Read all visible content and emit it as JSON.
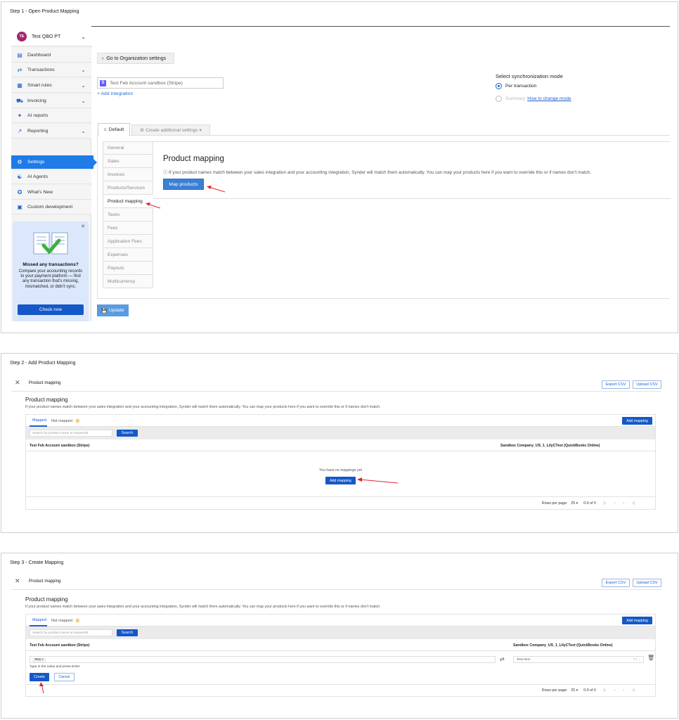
{
  "step1": {
    "title": "Step 1 - Open Product Mapping",
    "org": {
      "initials": "TE",
      "name": "Test QBO PT"
    },
    "nav": [
      {
        "label": "Dashboard",
        "icon": "dashboard-icon"
      },
      {
        "label": "Transactions",
        "icon": "transactions-icon"
      },
      {
        "label": "Smart rules",
        "icon": "smart-rules-icon"
      },
      {
        "label": "Invoicing",
        "icon": "cart-icon"
      },
      {
        "label": "AI reports",
        "icon": "sparkle-icon"
      },
      {
        "label": "Reporting",
        "icon": "chart-line-icon"
      },
      {
        "label": "Settings",
        "icon": "gear-icon"
      },
      {
        "label": "AI Agents",
        "icon": "ai-agents-icon"
      },
      {
        "label": "What's New",
        "icon": "star-icon"
      },
      {
        "label": "Custom development",
        "icon": "code-icon"
      }
    ],
    "promo": {
      "title": "Missed any transactions?",
      "text": "Compare your accounting records to your payment platform — find any transaction that's missing, mismatched, or didn't sync.",
      "button": "Check now"
    },
    "back_button": "Go to Organization settings",
    "integration_value": "Test Feb Account  sandbox (Stripe)",
    "add_integration": "Add integration",
    "sync": {
      "title": "Select synchronization mode",
      "per_transaction": "Per transaction",
      "summary": "Summary",
      "how_link": "How to change mode"
    },
    "tabs": {
      "default": "Default",
      "create": "Create additional settings"
    },
    "menu": [
      "General",
      "Sales",
      "Invoices",
      "Products/Services",
      "Product mapping",
      "Taxes",
      "Fees",
      "Application Fees",
      "Expenses",
      "Payouts",
      "Multicurrency"
    ],
    "panel": {
      "title": "Product mapping",
      "info": "If your product names match between your sales integration and your accounting integration, Synder will match them automatically. You can map your products here if you want to override this or if names don't match.",
      "button": "Map products"
    },
    "update_button": "Update"
  },
  "step2": {
    "title": "Step 2 - Add Product Mapping",
    "header": "Product mapping",
    "export_csv": "Export CSV",
    "upload_csv": "Upload CSV",
    "page_title": "Product mapping",
    "description": "If your product names match between your sales integration and your accounting integration, Synder will match them automatically. You can map your products here if you want to override this or if names don't match.",
    "tab_mapped": "Mapped",
    "tab_not_mapped": "Not mapped",
    "not_mapped_count": "0",
    "add_mapping": "Add mapping",
    "search_placeholder": "Search by product name or keywords",
    "search_button": "Search",
    "col_left": "Test Feb Account sandbox (Stripe)",
    "col_right": "Sandbox Company_US_1_LilyCTest (QuickBooks Online)",
    "empty_text": "You have no mappings yet",
    "empty_button": "Add mapping",
    "rows_per_page_label": "Rows per page:",
    "rows_per_page": "25",
    "range": "0-0 of 0"
  },
  "step3": {
    "title": "Step 3 - Create Mapping",
    "header": "Product mapping",
    "export_csv": "Export CSV",
    "upload_csv": "Upload CSV",
    "page_title": "Product mapping",
    "description": "If your product names match between your sales integration and your accounting integration, Synder will match them automatically. You can map your products here if you want to override this or if names don't match.",
    "tab_mapped": "Mapped",
    "tab_not_mapped": "Not mapped",
    "not_mapped_count": "0",
    "add_mapping": "Add mapping",
    "search_placeholder": "Search by product name or keywords",
    "search_button": "Search",
    "col_left": "Test Feb Account sandbox (Stripe)",
    "col_right": "Sandbox Company_US_1_LilyCTest (QuickBooks Online)",
    "tag_value": "Test",
    "hint": "Type in the value and press Enter",
    "select_value": "Test Item",
    "create_button": "Create",
    "cancel_button": "Cancel",
    "rows_per_page_label": "Rows per page:",
    "rows_per_page": "25",
    "range": "0-0 of 0"
  },
  "colors": {
    "primary": "#1558c7",
    "active_nav": "#1e7be8",
    "arrow": "#e0262a",
    "org_badge": "#a4256a"
  }
}
